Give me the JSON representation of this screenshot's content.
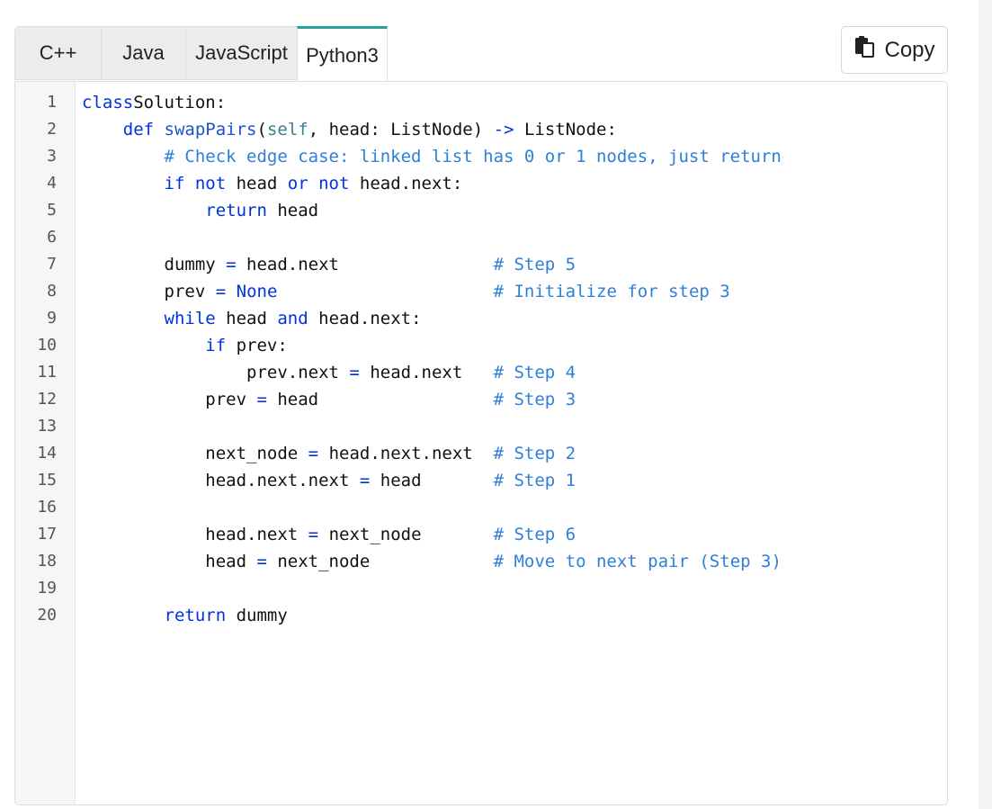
{
  "tabs": [
    "C++",
    "Java",
    "JavaScript",
    "Python3"
  ],
  "active_tab": "Python3",
  "copy_button": {
    "label": "Copy",
    "icon": "clipboard-icon"
  },
  "colors": {
    "accent": "#24a29a",
    "keyword": "#0033dd",
    "comment": "#2e7fd8"
  },
  "code_lines": [
    [
      [
        "kw",
        "class"
      ],
      [
        "",
        "Solution:"
      ]
    ],
    [
      [
        "",
        "    "
      ],
      [
        "kw",
        "def"
      ],
      [
        "",
        "",
        " "
      ],
      [
        "fn",
        "swapPairs"
      ],
      [
        "",
        "("
      ],
      [
        "bi",
        "self"
      ],
      [
        "",
        ", head: ListNode) "
      ],
      [
        "op",
        "->"
      ],
      [
        "",
        " ListNode:"
      ]
    ],
    [
      [
        "",
        "        "
      ],
      [
        "cm",
        "# Check edge case: linked list has 0 or 1 nodes, just return"
      ]
    ],
    [
      [
        "",
        "        "
      ],
      [
        "kw",
        "if not"
      ],
      [
        "",
        " head "
      ],
      [
        "kw",
        "or not"
      ],
      [
        "",
        " head.next:"
      ]
    ],
    [
      [
        "",
        "            "
      ],
      [
        "kw",
        "return"
      ],
      [
        "",
        " head"
      ]
    ],
    [],
    [
      [
        "",
        "        dummy "
      ],
      [
        "op",
        "="
      ],
      [
        "",
        " head.next               "
      ],
      [
        "cm",
        "# Step 5"
      ]
    ],
    [
      [
        "",
        "        prev "
      ],
      [
        "op",
        "="
      ],
      [
        "",
        " "
      ],
      [
        "kw",
        "None"
      ],
      [
        "",
        "                     "
      ],
      [
        "cm",
        "# Initialize for step 3"
      ]
    ],
    [
      [
        "",
        "        "
      ],
      [
        "kw",
        "while"
      ],
      [
        "",
        " head "
      ],
      [
        "kw",
        "and"
      ],
      [
        "",
        " head.next:"
      ]
    ],
    [
      [
        "",
        "            "
      ],
      [
        "kw",
        "if"
      ],
      [
        "",
        " prev:"
      ]
    ],
    [
      [
        "",
        "                prev.next "
      ],
      [
        "op",
        "="
      ],
      [
        "",
        " head.next   "
      ],
      [
        "cm",
        "# Step 4"
      ]
    ],
    [
      [
        "",
        "            prev "
      ],
      [
        "op",
        "="
      ],
      [
        "",
        " head                 "
      ],
      [
        "cm",
        "# Step 3"
      ]
    ],
    [],
    [
      [
        "",
        "            next_node "
      ],
      [
        "op",
        "="
      ],
      [
        "",
        " head.next.next  "
      ],
      [
        "cm",
        "# Step 2"
      ]
    ],
    [
      [
        "",
        "            head.next.next "
      ],
      [
        "op",
        "="
      ],
      [
        "",
        " head       "
      ],
      [
        "cm",
        "# Step 1"
      ]
    ],
    [],
    [
      [
        "",
        "            head.next "
      ],
      [
        "op",
        "="
      ],
      [
        "",
        " next_node       "
      ],
      [
        "cm",
        "# Step 6"
      ]
    ],
    [
      [
        "",
        "            head "
      ],
      [
        "op",
        "="
      ],
      [
        "",
        " next_node            "
      ],
      [
        "cm",
        "# Move to next pair (Step 3)"
      ]
    ],
    [],
    [
      [
        "",
        "        "
      ],
      [
        "kw",
        "return"
      ],
      [
        "",
        " dummy"
      ]
    ]
  ],
  "line_numbers": [
    "1",
    "2",
    "3",
    "4",
    "5",
    "6",
    "7",
    "8",
    "9",
    "10",
    "11",
    "12",
    "13",
    "14",
    "15",
    "16",
    "17",
    "18",
    "19",
    "20"
  ]
}
